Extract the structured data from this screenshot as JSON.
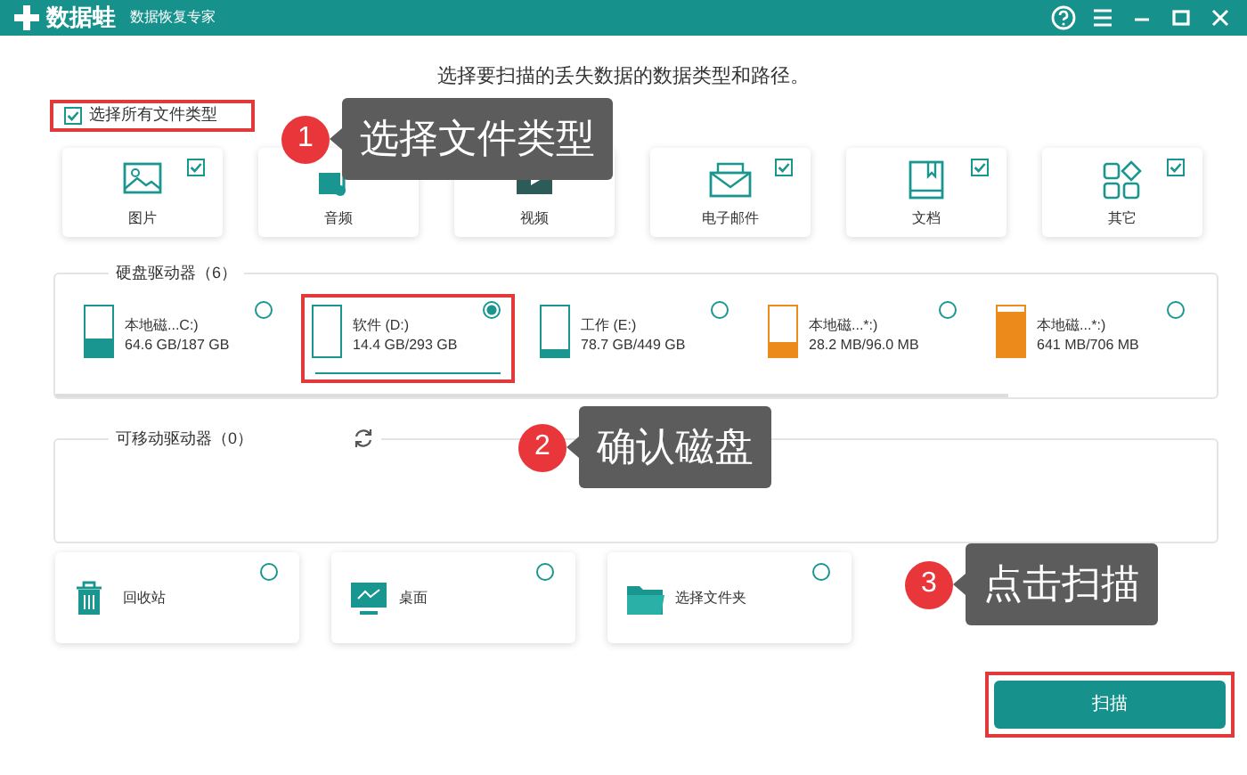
{
  "app": {
    "name": "数据蛙",
    "subtitle": "数据恢复专家"
  },
  "heading": "选择要扫描的丢失数据的数据类型和路径。",
  "select_all": {
    "label": "选择所有文件类型",
    "checked": true,
    "highlighted": true
  },
  "file_types": [
    {
      "kind": "image",
      "label": "图片",
      "checked": true
    },
    {
      "kind": "audio",
      "label": "音频"
    },
    {
      "kind": "video",
      "label": "视频"
    },
    {
      "kind": "email",
      "label": "电子邮件",
      "checked": true
    },
    {
      "kind": "document",
      "label": "文档",
      "checked": true
    },
    {
      "kind": "other",
      "label": "其它",
      "checked": true
    }
  ],
  "hard_drives": {
    "title": "硬盘驱动器（6）",
    "items": [
      {
        "name": "本地磁...C:)",
        "size": "64.6 GB/187 GB",
        "level": 0.35,
        "color": "#1a9690",
        "selected": false,
        "highlighted": false
      },
      {
        "name": "软件 (D:)",
        "size": "14.4 GB/293 GB",
        "level": 0,
        "color": "#1a9690",
        "selected": true,
        "highlighted": true
      },
      {
        "name": "工作 (E:)",
        "size": "78.7 GB/449 GB",
        "level": 0.15,
        "color": "#1a9690",
        "selected": false,
        "highlighted": false
      },
      {
        "name": "本地磁...*:)",
        "size": "28.2 MB/96.0 MB",
        "level": 0.3,
        "color": "#ec8a1c",
        "selected": false,
        "highlighted": false
      },
      {
        "name": "本地磁...*:)",
        "size": "641 MB/706 MB",
        "level": 0.9,
        "color": "#ec8a1c",
        "selected": false,
        "highlighted": false
      }
    ]
  },
  "removable": {
    "title": "可移动驱动器（0）"
  },
  "locations": [
    {
      "kind": "recycle",
      "label": "回收站",
      "selected": false
    },
    {
      "kind": "desktop",
      "label": "桌面",
      "selected": false
    },
    {
      "kind": "folder",
      "label": "选择文件夹",
      "selected": false
    }
  ],
  "scan_button": {
    "label": "扫描",
    "highlighted": true
  },
  "callouts": [
    {
      "number": "1",
      "text": "选择文件类型"
    },
    {
      "number": "2",
      "text": "确认磁盘"
    },
    {
      "number": "3",
      "text": "点击扫描"
    }
  ]
}
